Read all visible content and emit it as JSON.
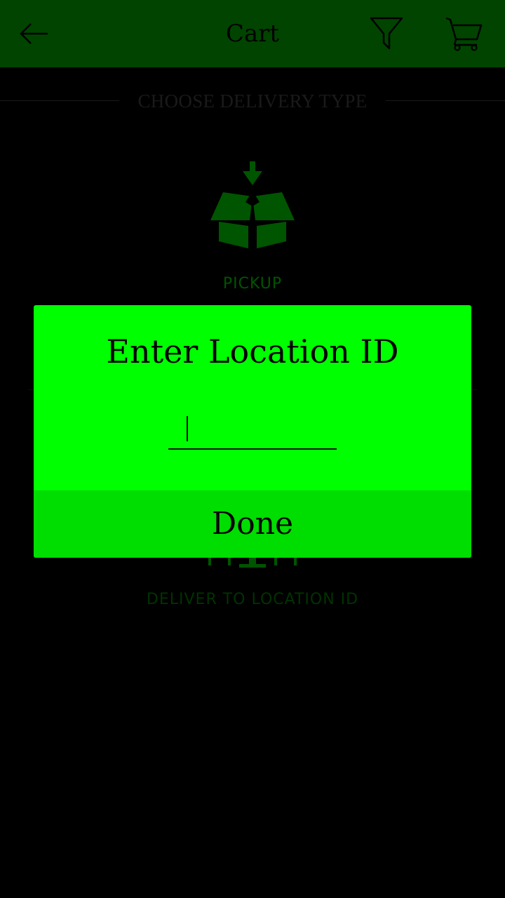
{
  "header": {
    "title": "Cart",
    "back_icon": "arrow-left-icon",
    "filter_icon": "filter-icon",
    "cart_icon": "cart-icon"
  },
  "section": {
    "title": "CHOOSE DELIVERY TYPE"
  },
  "options": [
    {
      "label": "PICKUP",
      "icon": "open-box-icon"
    },
    {
      "label": "DELIVER TO LOCATION ID",
      "icon": "delivery-icon"
    }
  ],
  "dialog": {
    "title": "Enter Location ID",
    "input_value": "",
    "button_label": "Done"
  },
  "colors": {
    "header_bg": "#004400",
    "dialog_bg": "#00ff00",
    "button_bg": "#00dd00",
    "page_bg": "#000000"
  }
}
